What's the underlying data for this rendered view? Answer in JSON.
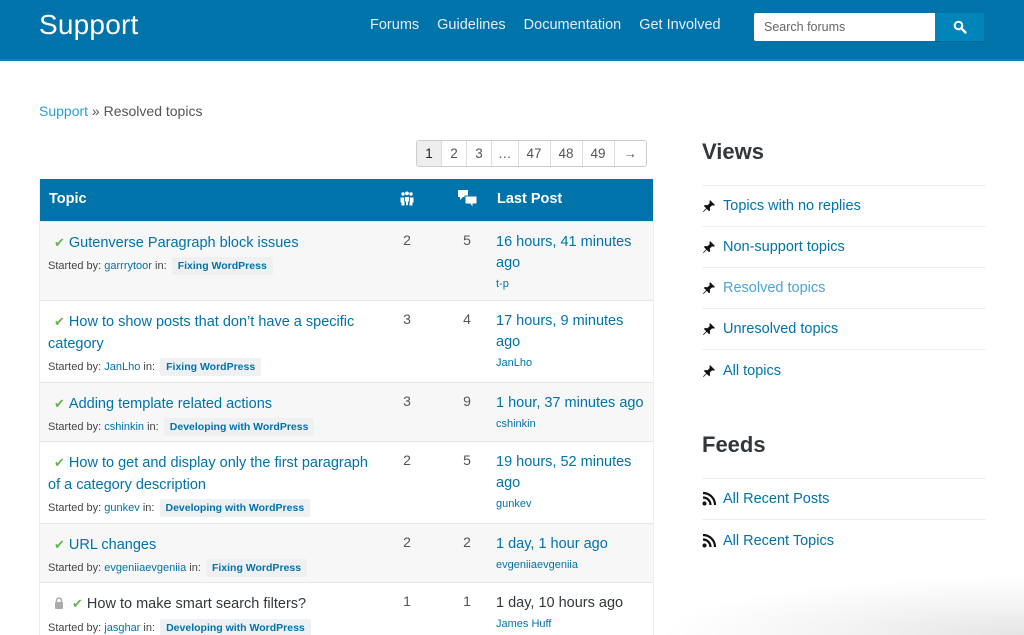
{
  "header": {
    "site_title": "Support",
    "nav": [
      {
        "label": "Forums"
      },
      {
        "label": "Guidelines"
      },
      {
        "label": "Documentation"
      },
      {
        "label": "Get Involved"
      }
    ],
    "search": {
      "placeholder": "Search forums",
      "value": "",
      "button_icon": "search-icon"
    }
  },
  "breadcrumb": {
    "root": "Support",
    "separator": " » ",
    "current": "Resolved topics"
  },
  "pagination": {
    "current": "1",
    "pages": [
      "1",
      "2",
      "3",
      "…",
      "47",
      "48",
      "49"
    ],
    "next": "→"
  },
  "table": {
    "columns": {
      "topic": "Topic",
      "voices_icon": "voices-icon",
      "posts_icon": "posts-icon",
      "last_post": "Last Post"
    },
    "started_by_label": "Started by:",
    "in_label": "in:",
    "rows": [
      {
        "title": "Gutenverse Paragraph block issues",
        "resolved": true,
        "closed": false,
        "author": "garrrytoor",
        "forum": "Fixing WordPress",
        "voices": "2",
        "posts": "5",
        "last_post_time": "16 hours, 41 minutes ago",
        "last_post_by": "t-p"
      },
      {
        "title": "How to show posts that don’t have a specific category",
        "resolved": true,
        "closed": false,
        "author": "JanLho",
        "forum": "Fixing WordPress",
        "voices": "3",
        "posts": "4",
        "last_post_time": "17 hours, 9 minutes ago",
        "last_post_by": "JanLho"
      },
      {
        "title": "Adding template related actions",
        "resolved": true,
        "closed": false,
        "author": "cshinkin",
        "forum": "Developing with WordPress",
        "voices": "3",
        "posts": "9",
        "last_post_time": "1 hour, 37 minutes ago",
        "last_post_by": "cshinkin"
      },
      {
        "title": "How to get and display only the first paragraph of a category description",
        "resolved": true,
        "closed": false,
        "author": "gunkev",
        "forum": "Developing with WordPress",
        "voices": "2",
        "posts": "5",
        "last_post_time": "19 hours, 52 minutes ago",
        "last_post_by": "gunkev"
      },
      {
        "title": "URL changes",
        "resolved": true,
        "closed": false,
        "author": "evgeniiaevgeniia",
        "forum": "Fixing WordPress",
        "voices": "2",
        "posts": "2",
        "last_post_time": "1 day, 1 hour ago",
        "last_post_by": "evgeniiaevgeniia"
      },
      {
        "title": "How to make smart search filters?",
        "resolved": true,
        "closed": true,
        "author": "jasghar",
        "forum": "Developing with WordPress",
        "voices": "1",
        "posts": "1",
        "last_post_time": "1 day, 10 hours ago",
        "last_post_by": "James Huff"
      }
    ]
  },
  "sidebar": {
    "views": {
      "title": "Views",
      "items": [
        {
          "label": "Topics with no replies",
          "icon": "pin-icon",
          "active": false
        },
        {
          "label": "Non-support topics",
          "icon": "pin-icon",
          "active": false
        },
        {
          "label": "Resolved topics",
          "icon": "pin-icon",
          "active": true
        },
        {
          "label": "Unresolved topics",
          "icon": "pin-icon",
          "active": false
        },
        {
          "label": "All topics",
          "icon": "pin-icon",
          "active": false
        }
      ]
    },
    "feeds": {
      "title": "Feeds",
      "items": [
        {
          "label": "All Recent Posts",
          "icon": "rss-icon"
        },
        {
          "label": "All Recent Topics",
          "icon": "rss-icon"
        }
      ]
    }
  },
  "colors": {
    "brand_blue": "#0073aa",
    "link_blue": "#0073aa",
    "active_link": "#4aa6d6",
    "resolved_check": "#64b450",
    "text": "#32373c"
  }
}
